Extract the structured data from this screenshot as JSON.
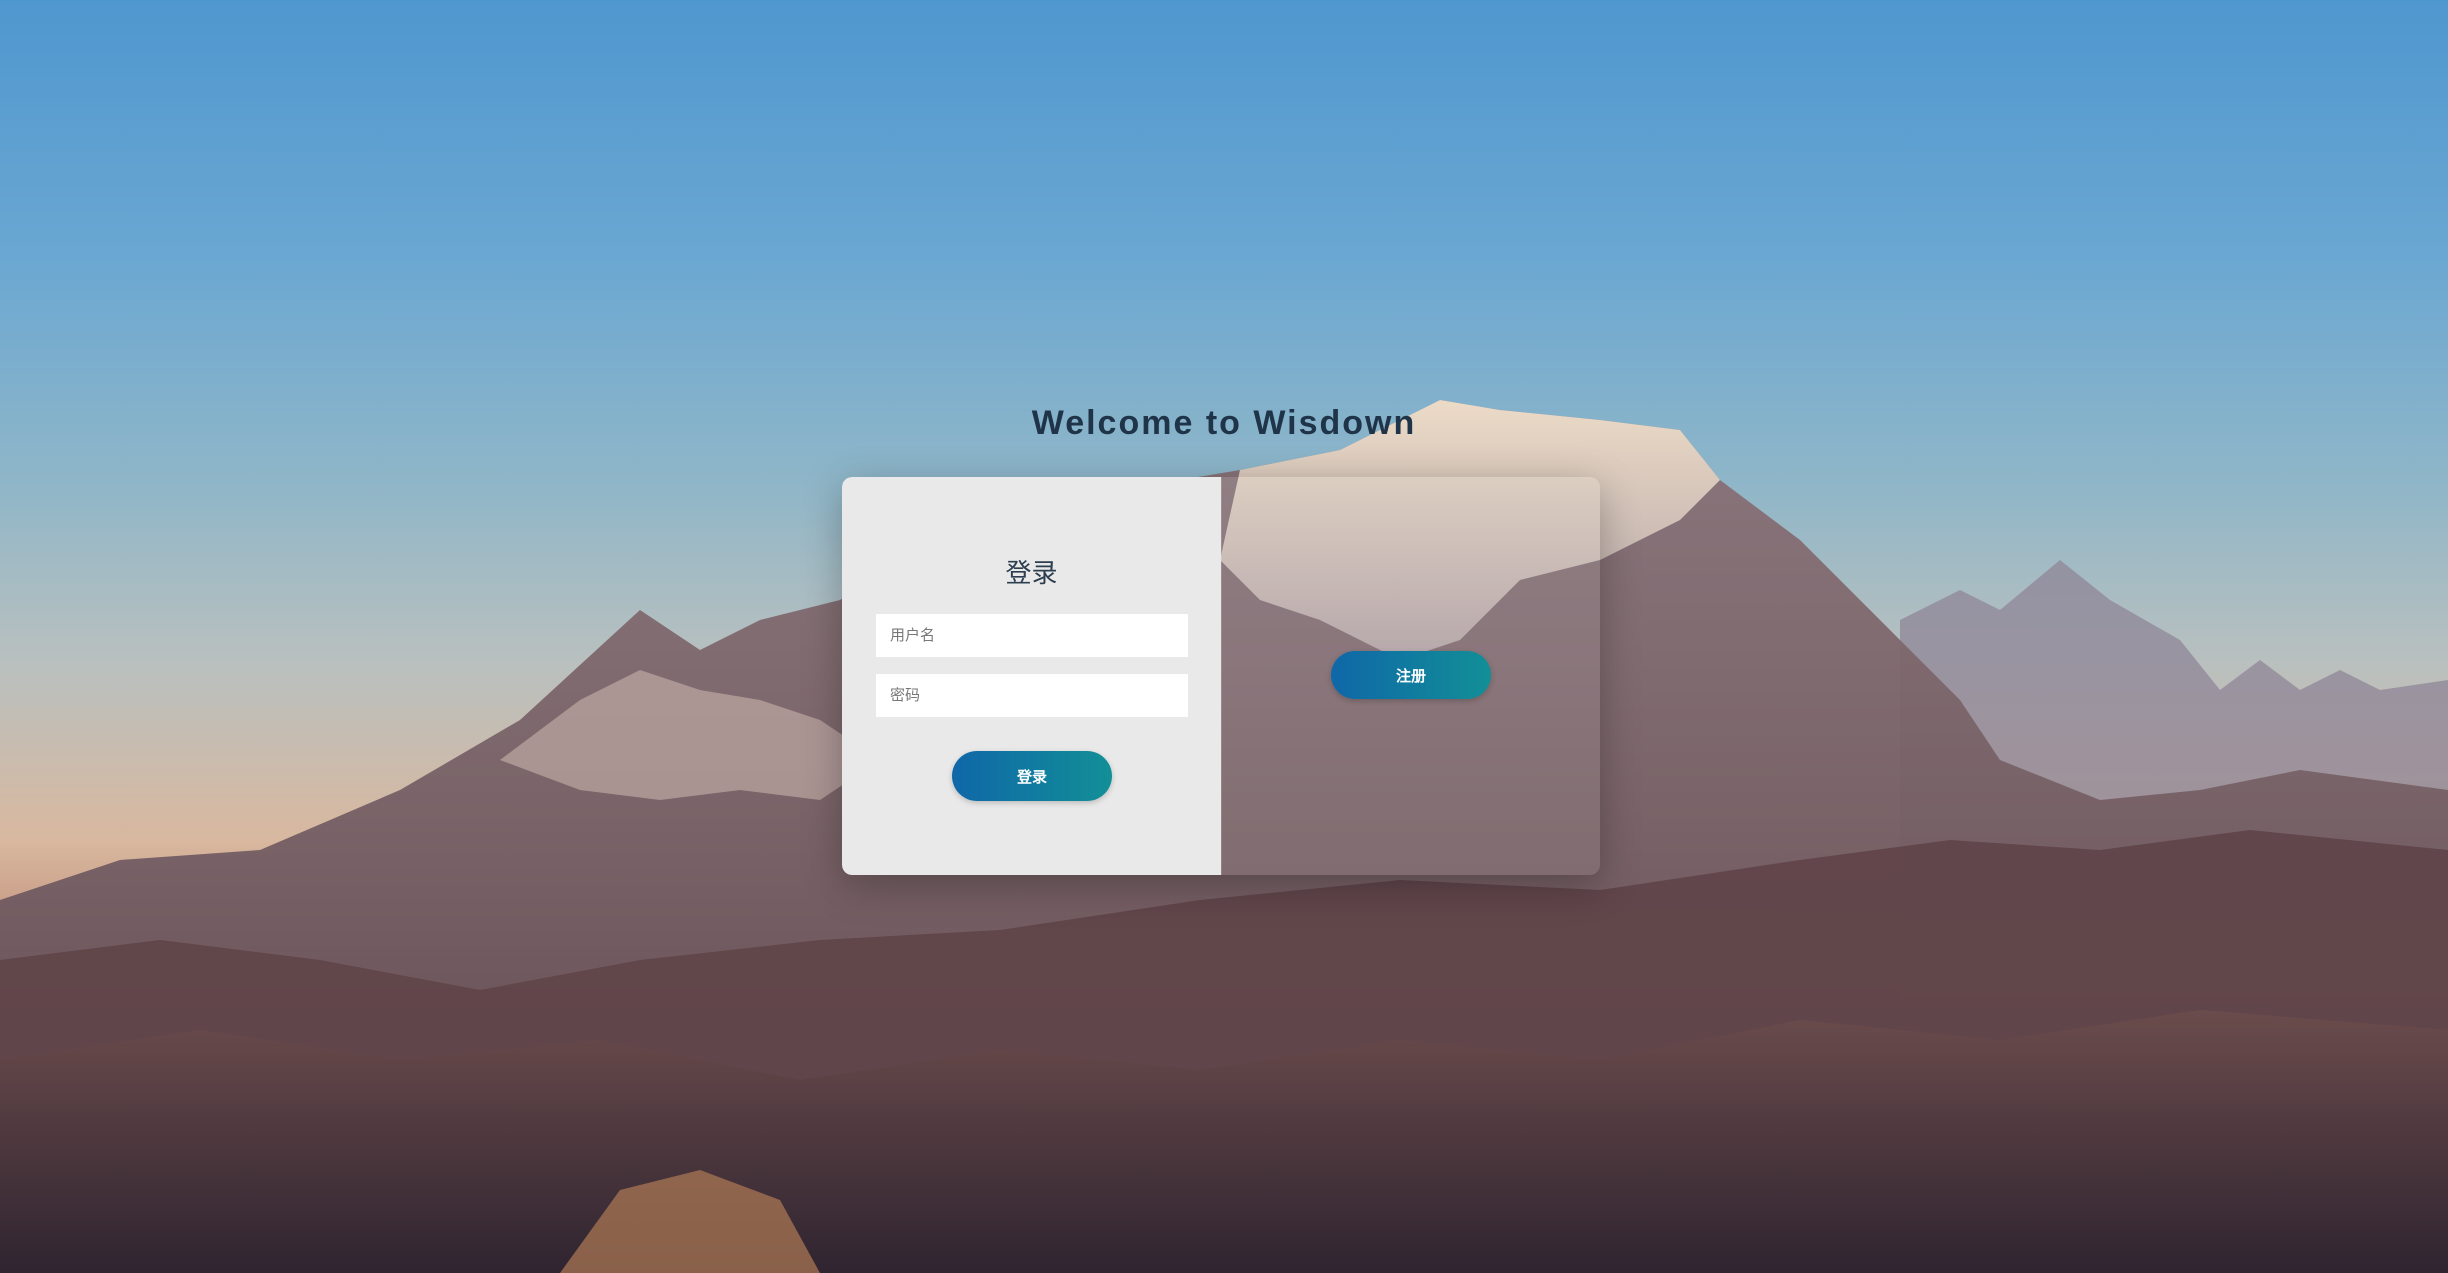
{
  "welcome_text": "Welcome to Wisdown",
  "login": {
    "title": "登录",
    "username_placeholder": "用户名",
    "password_placeholder": "密码",
    "submit_label": "登录"
  },
  "register": {
    "label": "注册"
  },
  "colors": {
    "button_start": "#0f67a8",
    "button_end": "#128f97",
    "card_bg": "#e9e9e9",
    "title_text": "#1f3448"
  },
  "background": "mountain-landscape-image"
}
